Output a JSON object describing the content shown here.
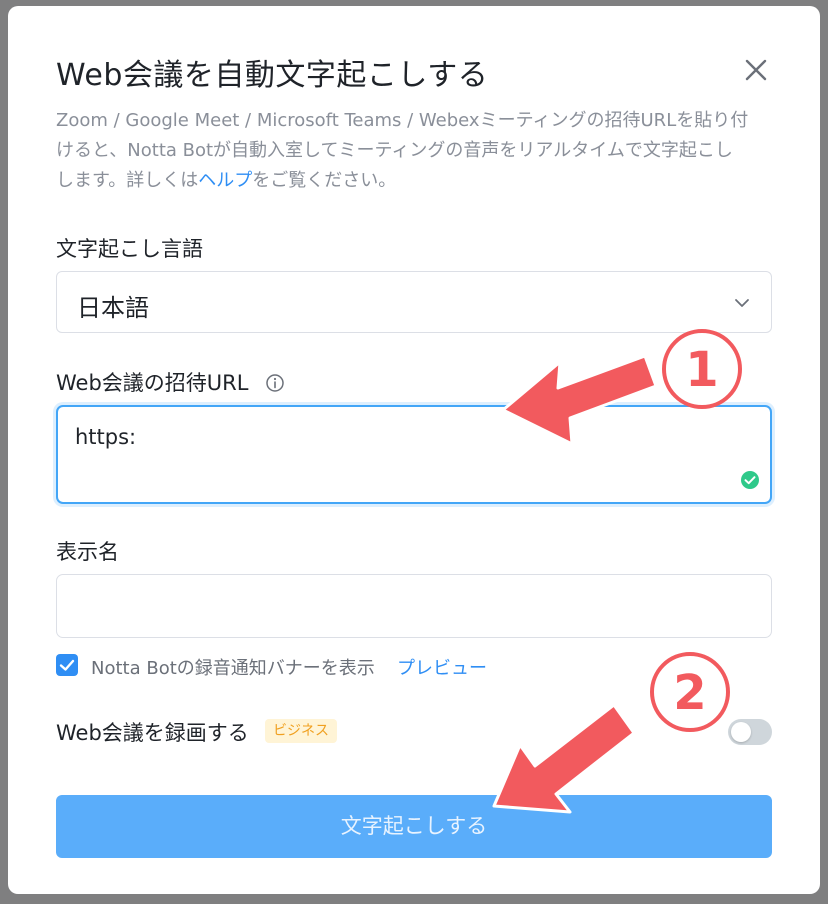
{
  "dialog": {
    "title": "Web会議を自動文字起こしする",
    "description_line1": "Zoom / Google Meet / Microsoft Teams / Webexミーティングの招待URLを貼り付",
    "description_line2": "けると、Notta Botが自動入室してミーティングの音声をリアルタイムで文字起こし",
    "description_line3_pre": "します。詳しくは",
    "description_link": "ヘルプ",
    "description_line3_post": "をご覧ください。"
  },
  "language": {
    "label": "文字起こし言語",
    "value": "日本語"
  },
  "url_field": {
    "label": "Web会議の招待URL",
    "value": "https:"
  },
  "display_name": {
    "label": "表示名",
    "value": ""
  },
  "notification": {
    "label": "Notta Botの録音通知バナーを表示",
    "preview_link": "プレビュー",
    "checked": true
  },
  "record": {
    "label": "Web会議を録画する",
    "badge": "ビジネス",
    "enabled": false
  },
  "submit_label": "文字起こしする",
  "annotations": {
    "step1": "1",
    "step2": "2",
    "arrow_color": "#f25a5e"
  },
  "colors": {
    "accent": "#2f8ef4",
    "submit_bg": "#5aadfa",
    "success": "#2fc98a",
    "badge_bg": "#fff4d6",
    "badge_text": "#f0a020"
  }
}
